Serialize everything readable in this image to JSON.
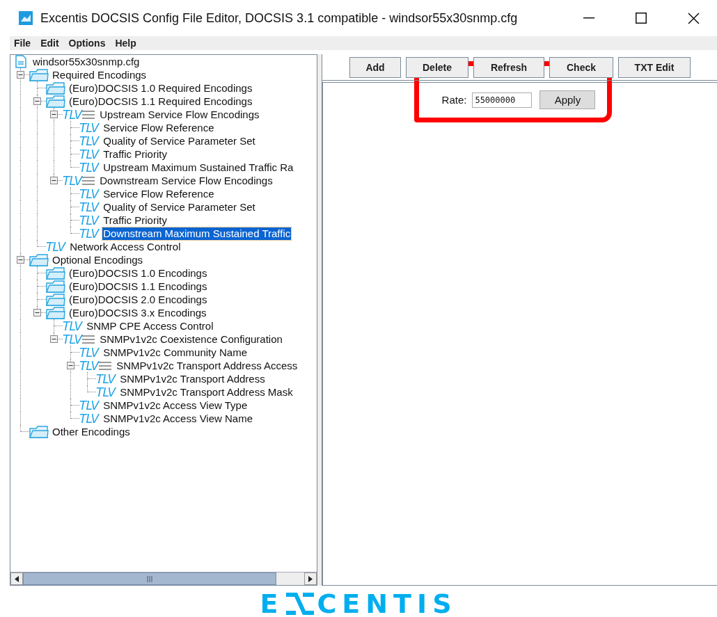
{
  "window": {
    "title": "Excentis DOCSIS Config File Editor, DOCSIS 3.1 compatible - windsor55x30snmp.cfg"
  },
  "menu": [
    "File",
    "Edit",
    "Options",
    "Help"
  ],
  "tree": {
    "root": {
      "label": "windsor55x30snmp.cfg",
      "selected": false
    },
    "items": [
      {
        "kind": "folder",
        "label": "Required Encodings",
        "expanded": true,
        "selected": false,
        "children": [
          {
            "kind": "folder",
            "label": "(Euro)DOCSIS 1.0 Required Encodings",
            "selected": false
          },
          {
            "kind": "folder",
            "label": "(Euro)DOCSIS 1.1 Required Encodings",
            "expanded": true,
            "selected": false,
            "children": [
              {
                "kind": "tlv-group",
                "badge": "TLV",
                "label": "Upstream Service Flow Encodings",
                "expanded": true,
                "selected": false,
                "children": [
                  {
                    "kind": "tlv",
                    "badge": "TLV",
                    "label": "Service Flow Reference",
                    "selected": false
                  },
                  {
                    "kind": "tlv",
                    "badge": "TLV",
                    "label": "Quality of Service Parameter Set",
                    "selected": false
                  },
                  {
                    "kind": "tlv",
                    "badge": "TLV",
                    "label": "Traffic Priority",
                    "selected": false
                  },
                  {
                    "kind": "tlv",
                    "badge": "TLV",
                    "label": "Upstream Maximum Sustained Traffic Ra",
                    "selected": false
                  }
                ]
              },
              {
                "kind": "tlv-group",
                "badge": "TLV",
                "label": "Downstream Service Flow Encodings",
                "expanded": true,
                "selected": false,
                "children": [
                  {
                    "kind": "tlv",
                    "badge": "TLV",
                    "label": "Service Flow Reference",
                    "selected": false
                  },
                  {
                    "kind": "tlv",
                    "badge": "TLV",
                    "label": "Quality of Service Parameter Set",
                    "selected": false
                  },
                  {
                    "kind": "tlv",
                    "badge": "TLV",
                    "label": "Traffic Priority",
                    "selected": false
                  },
                  {
                    "kind": "tlv",
                    "badge": "TLV",
                    "label": "Downstream Maximum Sustained Traffic",
                    "selected": true
                  }
                ]
              }
            ]
          },
          {
            "kind": "tlv",
            "badge": "TLV",
            "label": "Network Access Control",
            "selected": false
          }
        ]
      },
      {
        "kind": "folder",
        "label": "Optional Encodings",
        "expanded": true,
        "selected": false,
        "children": [
          {
            "kind": "folder",
            "label": "(Euro)DOCSIS 1.0 Encodings",
            "selected": false
          },
          {
            "kind": "folder",
            "label": "(Euro)DOCSIS 1.1 Encodings",
            "selected": false
          },
          {
            "kind": "folder",
            "label": "(Euro)DOCSIS 2.0 Encodings",
            "selected": false
          },
          {
            "kind": "folder",
            "label": "(Euro)DOCSIS 3.x Encodings",
            "expanded": true,
            "selected": false,
            "children": [
              {
                "kind": "tlv",
                "badge": "TLV",
                "label": "SNMP CPE Access Control",
                "selected": false
              },
              {
                "kind": "tlv-group",
                "badge": "TLV",
                "label": "SNMPv1v2c Coexistence Configuration",
                "expanded": true,
                "selected": false,
                "children": [
                  {
                    "kind": "tlv",
                    "badge": "TLV",
                    "label": "SNMPv1v2c Community Name",
                    "selected": false
                  },
                  {
                    "kind": "tlv-group",
                    "badge": "TLV",
                    "label": "SNMPv1v2c Transport Address Access",
                    "expanded": true,
                    "selected": false,
                    "children": [
                      {
                        "kind": "tlv",
                        "badge": "TLV",
                        "label": "SNMPv1v2c Transport Address",
                        "selected": false
                      },
                      {
                        "kind": "tlv",
                        "badge": "TLV",
                        "label": "SNMPv1v2c Transport Address Mask",
                        "selected": false
                      }
                    ]
                  },
                  {
                    "kind": "tlv",
                    "badge": "TLV",
                    "label": "SNMPv1v2c Access View Type",
                    "selected": false
                  },
                  {
                    "kind": "tlv",
                    "badge": "TLV",
                    "label": "SNMPv1v2c Access View Name",
                    "selected": false
                  }
                ]
              }
            ]
          }
        ]
      },
      {
        "kind": "folder",
        "label": "Other Encodings",
        "selected": false
      }
    ]
  },
  "toolbar": [
    "Add",
    "Delete",
    "Refresh",
    "Check",
    "TXT Edit"
  ],
  "editor": {
    "label": "Rate:",
    "value": "55000000",
    "button": "Apply"
  },
  "logo": {
    "before": "E",
    "after": "CENTIS"
  }
}
